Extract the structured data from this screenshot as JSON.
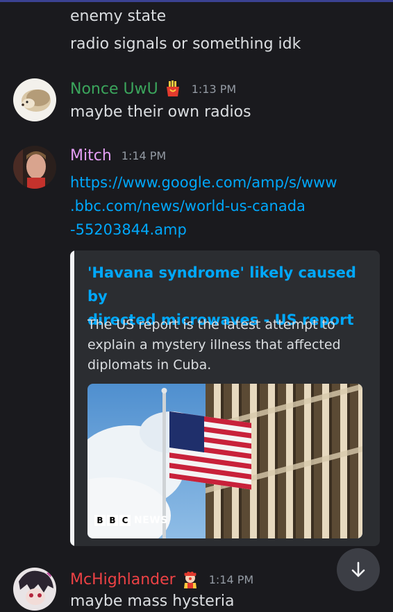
{
  "messages_prev": {
    "line_1": "enemy state",
    "line_2": "radio signals or something idk"
  },
  "message_nonce": {
    "username": "Nonce UwU",
    "username_color": "#3ba55c",
    "badge": "fries-icon",
    "timestamp": "1:13 PM",
    "text": "maybe their own radios"
  },
  "message_mitch": {
    "username": "Mitch",
    "username_color": "#e59ff5",
    "timestamp": "1:14 PM",
    "link_lines": [
      "https://www.google.com/amp/s/www",
      ".bbc.com/news/world-us-canada",
      "-55203844.amp"
    ],
    "embed": {
      "title_lines": [
        "'Havana syndrome' likely caused by",
        "directed microwaves - US report"
      ],
      "description_lines": [
        "The US report is the latest attempt to",
        "explain a mystery illness that affected",
        "diplomats in Cuba."
      ],
      "image_logo": {
        "b1": "B",
        "b2": "B",
        "c": "C",
        "news": "NEWS"
      }
    }
  },
  "message_mchighlander": {
    "username": "McHighlander",
    "username_color": "#ed4245",
    "badge": "clown-icon",
    "timestamp": "1:14 PM",
    "text": "maybe mass hysteria"
  },
  "colors": {
    "background": "#1a1a1e",
    "link": "#00a8fc",
    "embed_bg": "#2b2d31",
    "embed_bar": "#f2f3f5"
  },
  "scroll_button": {
    "icon": "arrow-down-icon"
  }
}
